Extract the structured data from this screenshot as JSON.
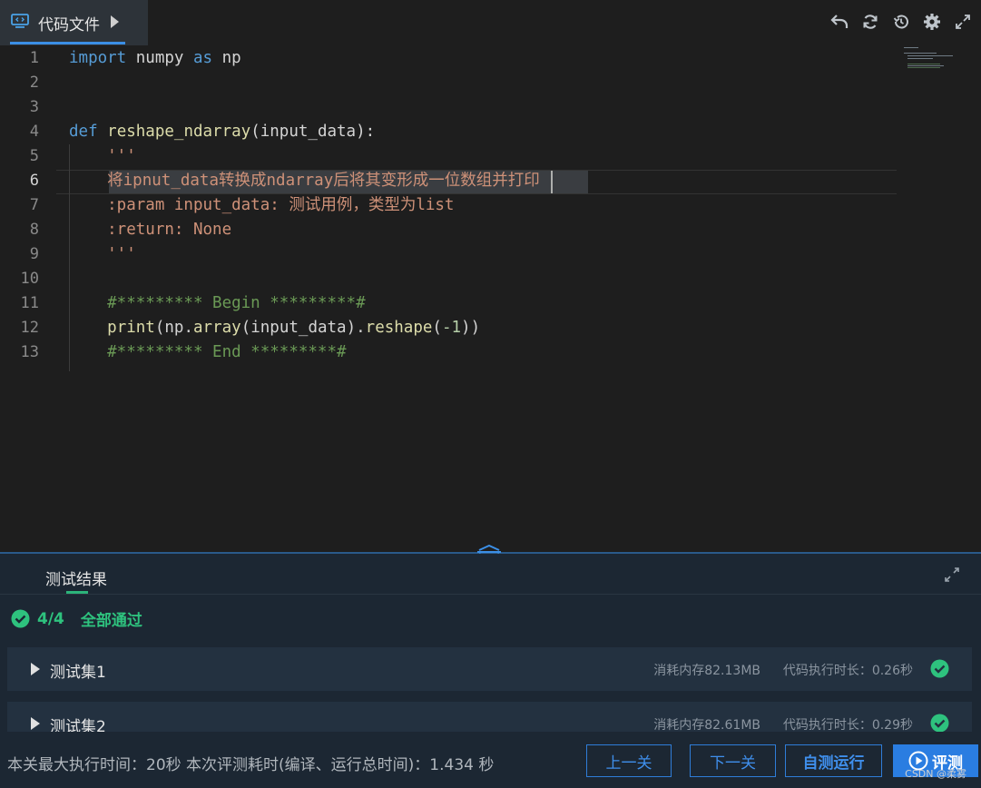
{
  "file_tab": {
    "label": "代码文件"
  },
  "toolbar": {
    "icons": [
      "undo-icon",
      "refresh-icon",
      "history-icon",
      "settings-icon",
      "fullscreen-icon"
    ]
  },
  "editor": {
    "line_numbers": [
      "1",
      "2",
      "3",
      "4",
      "5",
      "6",
      "7",
      "8",
      "9",
      "10",
      "11",
      "12",
      "13"
    ],
    "active_line": "6",
    "lines": [
      [
        {
          "t": "import",
          "c": "kw"
        },
        {
          "t": " numpy ",
          "c": "plain"
        },
        {
          "t": "as",
          "c": "kw"
        },
        {
          "t": " np",
          "c": "plain"
        }
      ],
      [],
      [],
      [
        {
          "t": "def",
          "c": "kw"
        },
        {
          "t": " ",
          "c": "plain"
        },
        {
          "t": "reshape_ndarray",
          "c": "fn"
        },
        {
          "t": "(input_data):",
          "c": "plain"
        }
      ],
      [
        {
          "t": "    '''",
          "c": "str"
        }
      ],
      [
        {
          "t": "    将ipnut_data转换成ndarray后将其变形成一位数组并打印",
          "c": "str"
        }
      ],
      [
        {
          "t": "    :param input_data: 测试用例，类型为list",
          "c": "str"
        }
      ],
      [
        {
          "t": "    :return: None",
          "c": "str"
        }
      ],
      [
        {
          "t": "    '''",
          "c": "str"
        }
      ],
      [],
      [
        {
          "t": "    #********* Begin *********#",
          "c": "cm"
        }
      ],
      [
        {
          "t": "    ",
          "c": "plain"
        },
        {
          "t": "print",
          "c": "fn"
        },
        {
          "t": "(np.",
          "c": "plain"
        },
        {
          "t": "array",
          "c": "fn"
        },
        {
          "t": "(input_data).",
          "c": "plain"
        },
        {
          "t": "reshape",
          "c": "fn"
        },
        {
          "t": "(",
          "c": "plain"
        },
        {
          "t": "-1",
          "c": "num"
        },
        {
          "t": "))",
          "c": "plain"
        }
      ],
      [
        {
          "t": "    #********* End *********#",
          "c": "cm"
        }
      ]
    ]
  },
  "results": {
    "tab_label": "测试结果",
    "pass_count": "4/4",
    "pass_text": "全部通过",
    "tests": [
      {
        "name": "测试集1",
        "memory": "消耗内存82.13MB",
        "time": "代码执行时长：0.26秒"
      },
      {
        "name": "测试集2",
        "memory": "消耗内存82.61MB",
        "time": "代码执行时长：0.29秒"
      }
    ]
  },
  "footer": {
    "info": "本关最大执行时间：20秒    本次评测耗时(编译、运行总时间)：1.434 秒",
    "prev_label": "上一关",
    "next_label": "下一关",
    "selftest_label": "自测运行",
    "evaluate_label": "评测",
    "watermark": "CSDN @柔雾"
  },
  "colors": {
    "accent": "#2a7de1",
    "pass": "#2ec27e",
    "keyword": "#569cd6",
    "string": "#ce9178",
    "comment": "#6a9955"
  }
}
